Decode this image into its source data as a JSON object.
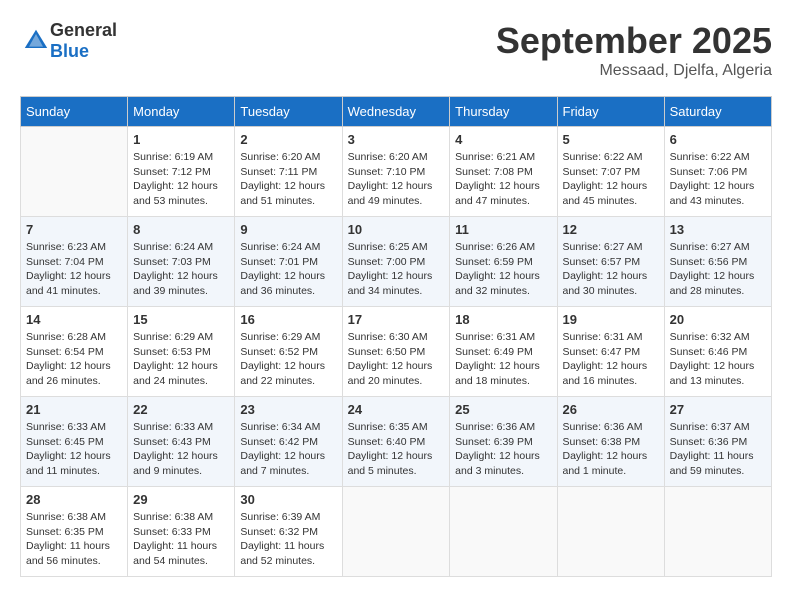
{
  "logo": {
    "text_general": "General",
    "text_blue": "Blue"
  },
  "header": {
    "month": "September 2025",
    "location": "Messaad, Djelfa, Algeria"
  },
  "weekdays": [
    "Sunday",
    "Monday",
    "Tuesday",
    "Wednesday",
    "Thursday",
    "Friday",
    "Saturday"
  ],
  "weeks": [
    [
      {
        "day": "",
        "info": ""
      },
      {
        "day": "1",
        "info": "Sunrise: 6:19 AM\nSunset: 7:12 PM\nDaylight: 12 hours\nand 53 minutes."
      },
      {
        "day": "2",
        "info": "Sunrise: 6:20 AM\nSunset: 7:11 PM\nDaylight: 12 hours\nand 51 minutes."
      },
      {
        "day": "3",
        "info": "Sunrise: 6:20 AM\nSunset: 7:10 PM\nDaylight: 12 hours\nand 49 minutes."
      },
      {
        "day": "4",
        "info": "Sunrise: 6:21 AM\nSunset: 7:08 PM\nDaylight: 12 hours\nand 47 minutes."
      },
      {
        "day": "5",
        "info": "Sunrise: 6:22 AM\nSunset: 7:07 PM\nDaylight: 12 hours\nand 45 minutes."
      },
      {
        "day": "6",
        "info": "Sunrise: 6:22 AM\nSunset: 7:06 PM\nDaylight: 12 hours\nand 43 minutes."
      }
    ],
    [
      {
        "day": "7",
        "info": "Sunrise: 6:23 AM\nSunset: 7:04 PM\nDaylight: 12 hours\nand 41 minutes."
      },
      {
        "day": "8",
        "info": "Sunrise: 6:24 AM\nSunset: 7:03 PM\nDaylight: 12 hours\nand 39 minutes."
      },
      {
        "day": "9",
        "info": "Sunrise: 6:24 AM\nSunset: 7:01 PM\nDaylight: 12 hours\nand 36 minutes."
      },
      {
        "day": "10",
        "info": "Sunrise: 6:25 AM\nSunset: 7:00 PM\nDaylight: 12 hours\nand 34 minutes."
      },
      {
        "day": "11",
        "info": "Sunrise: 6:26 AM\nSunset: 6:59 PM\nDaylight: 12 hours\nand 32 minutes."
      },
      {
        "day": "12",
        "info": "Sunrise: 6:27 AM\nSunset: 6:57 PM\nDaylight: 12 hours\nand 30 minutes."
      },
      {
        "day": "13",
        "info": "Sunrise: 6:27 AM\nSunset: 6:56 PM\nDaylight: 12 hours\nand 28 minutes."
      }
    ],
    [
      {
        "day": "14",
        "info": "Sunrise: 6:28 AM\nSunset: 6:54 PM\nDaylight: 12 hours\nand 26 minutes."
      },
      {
        "day": "15",
        "info": "Sunrise: 6:29 AM\nSunset: 6:53 PM\nDaylight: 12 hours\nand 24 minutes."
      },
      {
        "day": "16",
        "info": "Sunrise: 6:29 AM\nSunset: 6:52 PM\nDaylight: 12 hours\nand 22 minutes."
      },
      {
        "day": "17",
        "info": "Sunrise: 6:30 AM\nSunset: 6:50 PM\nDaylight: 12 hours\nand 20 minutes."
      },
      {
        "day": "18",
        "info": "Sunrise: 6:31 AM\nSunset: 6:49 PM\nDaylight: 12 hours\nand 18 minutes."
      },
      {
        "day": "19",
        "info": "Sunrise: 6:31 AM\nSunset: 6:47 PM\nDaylight: 12 hours\nand 16 minutes."
      },
      {
        "day": "20",
        "info": "Sunrise: 6:32 AM\nSunset: 6:46 PM\nDaylight: 12 hours\nand 13 minutes."
      }
    ],
    [
      {
        "day": "21",
        "info": "Sunrise: 6:33 AM\nSunset: 6:45 PM\nDaylight: 12 hours\nand 11 minutes."
      },
      {
        "day": "22",
        "info": "Sunrise: 6:33 AM\nSunset: 6:43 PM\nDaylight: 12 hours\nand 9 minutes."
      },
      {
        "day": "23",
        "info": "Sunrise: 6:34 AM\nSunset: 6:42 PM\nDaylight: 12 hours\nand 7 minutes."
      },
      {
        "day": "24",
        "info": "Sunrise: 6:35 AM\nSunset: 6:40 PM\nDaylight: 12 hours\nand 5 minutes."
      },
      {
        "day": "25",
        "info": "Sunrise: 6:36 AM\nSunset: 6:39 PM\nDaylight: 12 hours\nand 3 minutes."
      },
      {
        "day": "26",
        "info": "Sunrise: 6:36 AM\nSunset: 6:38 PM\nDaylight: 12 hours\nand 1 minute."
      },
      {
        "day": "27",
        "info": "Sunrise: 6:37 AM\nSunset: 6:36 PM\nDaylight: 11 hours\nand 59 minutes."
      }
    ],
    [
      {
        "day": "28",
        "info": "Sunrise: 6:38 AM\nSunset: 6:35 PM\nDaylight: 11 hours\nand 56 minutes."
      },
      {
        "day": "29",
        "info": "Sunrise: 6:38 AM\nSunset: 6:33 PM\nDaylight: 11 hours\nand 54 minutes."
      },
      {
        "day": "30",
        "info": "Sunrise: 6:39 AM\nSunset: 6:32 PM\nDaylight: 11 hours\nand 52 minutes."
      },
      {
        "day": "",
        "info": ""
      },
      {
        "day": "",
        "info": ""
      },
      {
        "day": "",
        "info": ""
      },
      {
        "day": "",
        "info": ""
      }
    ]
  ]
}
